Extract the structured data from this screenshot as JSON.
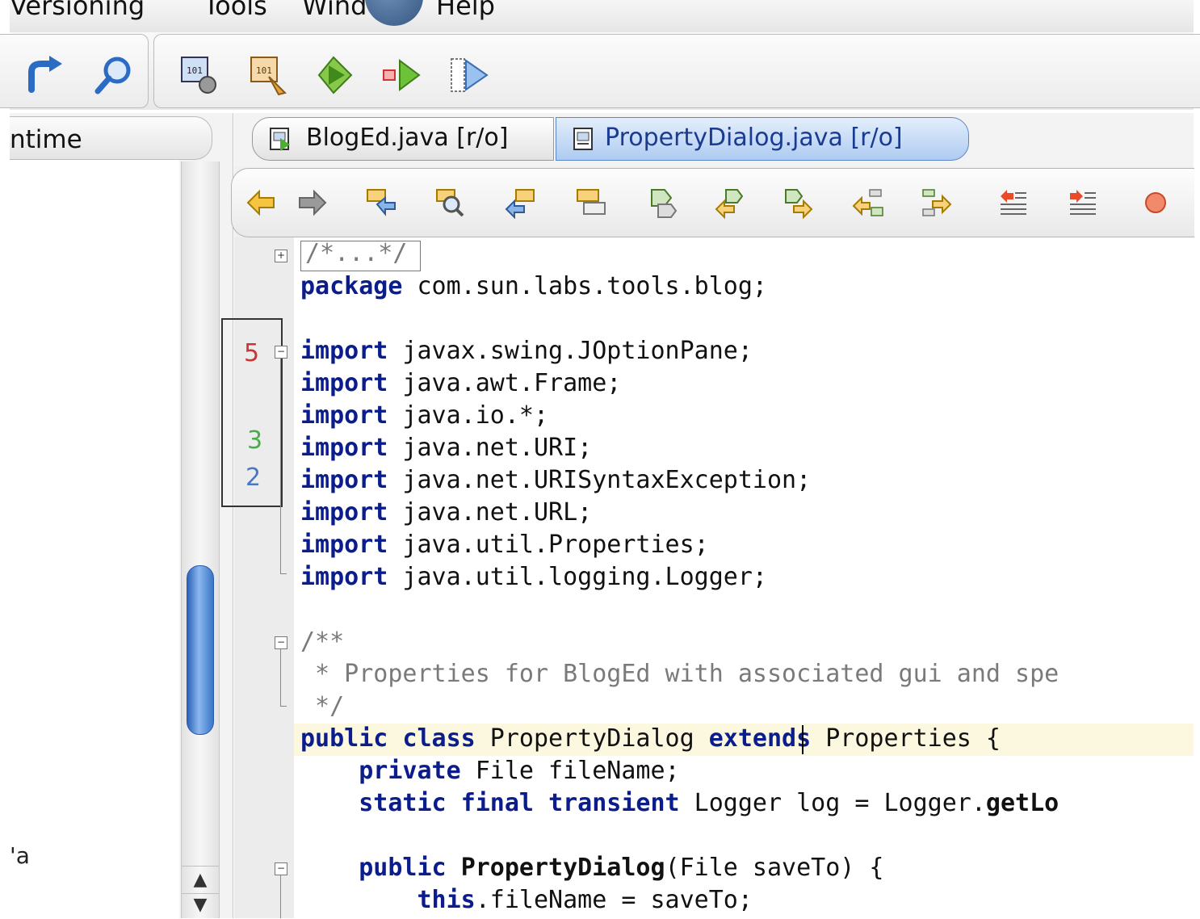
{
  "menubar": {
    "items": [
      "Versioning",
      "Tools",
      "Window",
      "Help"
    ]
  },
  "toolbar": {
    "icons": [
      "redo-icon",
      "find-icon",
      "build-project-icon",
      "clean-build-icon",
      "run-icon",
      "debug-icon",
      "profile-icon"
    ]
  },
  "left_panel": {
    "tab_label": "ntime",
    "item_fragment": "'a"
  },
  "editor": {
    "tabs": [
      {
        "label": "BlogEd.java [r/o]",
        "active": false
      },
      {
        "label": "PropertyDialog.java [r/o]",
        "active": true
      }
    ],
    "toolbar_icons": [
      "back-icon",
      "forward-icon",
      "find-selection-icon",
      "find-icon",
      "find-previous-icon",
      "toggle-highlight-icon",
      "previous-bookmark-icon",
      "next-bookmark-icon",
      "toggle-bookmark-icon",
      "shift-left-icon",
      "shift-right-icon",
      "comment-icon",
      "uncomment-icon",
      "record-macro-icon"
    ],
    "gutter_counts": [
      {
        "value": "5",
        "color": "#cc3333"
      },
      {
        "value": "3",
        "color": "#4caa4c"
      },
      {
        "value": "2",
        "color": "#4a78c2"
      }
    ],
    "code": {
      "collapsed_header": "/*...*/",
      "package_kw": "package",
      "package_rest": " com.sun.labs.tools.blog;",
      "import_kw": "import",
      "imports": [
        " javax.swing.JOptionPane;",
        " java.awt.Frame;",
        " java.io.*;",
        " java.net.URI;",
        " java.net.URISyntaxException;",
        " java.net.URL;",
        " java.util.Properties;",
        " java.util.logging.Logger;"
      ],
      "javadoc_open": "/**",
      "javadoc_body": " * Properties for BlogEd with associated gui and spe",
      "javadoc_close": " */",
      "class_kw1": "public",
      "class_kw2": "class",
      "class_name": " PropertyDialog ",
      "class_kw3": "extends",
      "class_rest": " Properties {",
      "field1_kw": "private",
      "field1_rest": " File fileName;",
      "field2_kw1": "static",
      "field2_kw2": "final",
      "field2_kw3": "transient",
      "field2_rest": " Logger log = Logger.",
      "field2_method": "getLo",
      "ctor_kw": "public",
      "ctor_name": "PropertyDialog",
      "ctor_rest": "(File saveTo) {",
      "assign_kw": "this",
      "assign_rest": ".fileName = saveTo;"
    }
  }
}
